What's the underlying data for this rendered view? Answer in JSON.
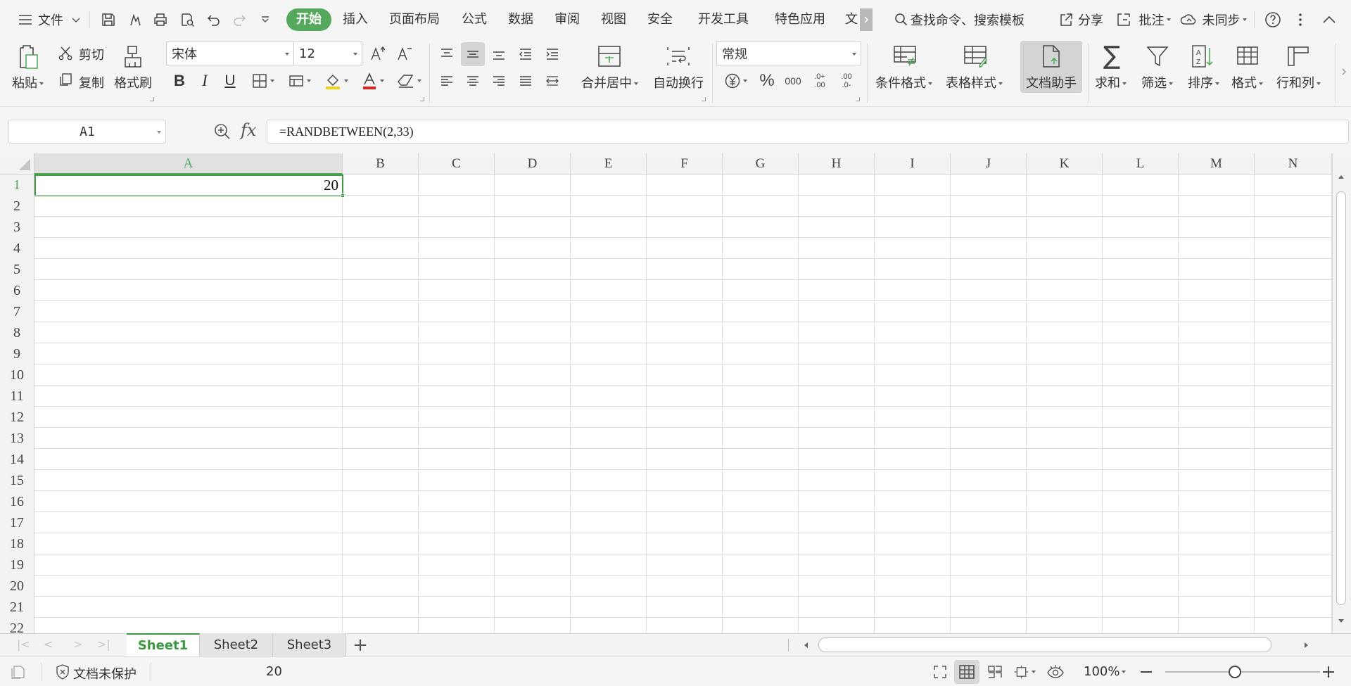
{
  "menubar": {
    "file_label": "文件",
    "tabs": [
      "开始",
      "插入",
      "页面布局",
      "公式",
      "数据",
      "审阅",
      "视图",
      "安全",
      "开发工具",
      "特色应用",
      "文"
    ],
    "active_tab": "开始",
    "search_placeholder": "查找命令、搜索模板",
    "share_label": "分享",
    "comment_label": "批注",
    "sync_label": "未同步"
  },
  "ribbon": {
    "clipboard": {
      "paste": "粘贴",
      "cut": "剪切",
      "copy": "复制",
      "format_painter": "格式刷"
    },
    "font": {
      "name": "宋体",
      "size": "12"
    },
    "alignment": {
      "merge_center": "合并居中",
      "wrap_text": "自动换行"
    },
    "number": {
      "format": "常规"
    },
    "styles": {
      "conditional_format": "条件格式",
      "table_style": "表格样式"
    },
    "doc_assistant": "文档助手",
    "editing": {
      "sum": "求和",
      "filter": "筛选",
      "sort": "排序",
      "format": "格式",
      "row_col": "行和列"
    }
  },
  "formula_bar": {
    "name_box": "A1",
    "fx_label": "fx",
    "formula": "=RANDBETWEEN(2,33)"
  },
  "grid": {
    "columns": [
      "A",
      "B",
      "C",
      "D",
      "E",
      "F",
      "G",
      "H",
      "I",
      "J",
      "K",
      "L",
      "M",
      "N"
    ],
    "rows": [
      "1",
      "2",
      "3",
      "4",
      "5",
      "6",
      "7",
      "8",
      "9",
      "10",
      "11",
      "12",
      "13",
      "14",
      "15",
      "16",
      "17",
      "18",
      "19",
      "20",
      "21",
      "22"
    ],
    "selected_cell": "A1",
    "cells": {
      "A1": "20"
    }
  },
  "sheets": {
    "tabs": [
      "Sheet1",
      "Sheet2",
      "Sheet3"
    ],
    "active": "Sheet1",
    "add_label": "+"
  },
  "statusbar": {
    "protection": "文档未保护",
    "cell_value": "20",
    "zoom": "100%"
  },
  "colors": {
    "accent": "#55a85c",
    "selection": "#3b9a3f"
  }
}
